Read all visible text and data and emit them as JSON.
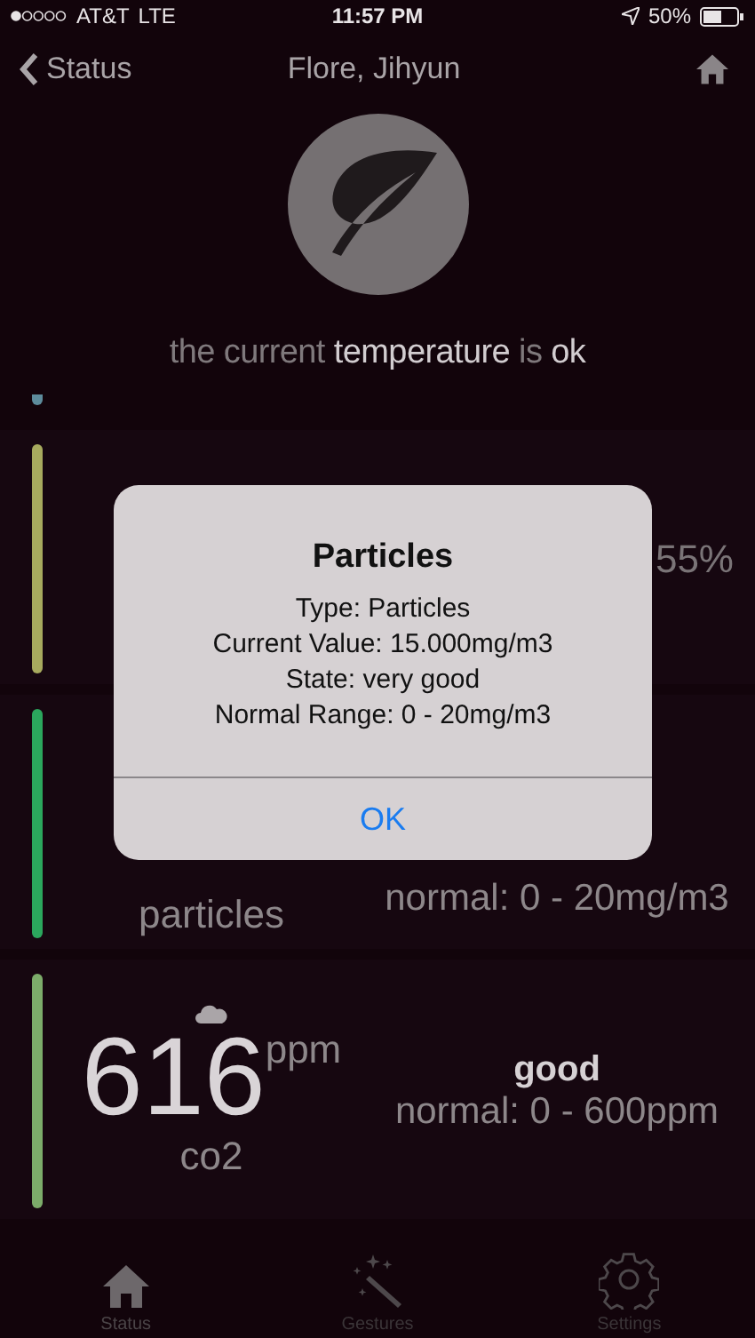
{
  "status_bar": {
    "carrier": "AT&T",
    "network": "LTE",
    "time": "11:57 PM",
    "battery": "50%"
  },
  "nav": {
    "back": "Status",
    "title": "Flore, Jihyun"
  },
  "caption": "the current **temperature** is **ok**",
  "sensors": [
    {
      "color": "#5d8c9c"
    },
    {
      "color": "#a7aa5e",
      "state": "55%"
    },
    {
      "color": "#2ba75d",
      "label": "particles",
      "range": "normal: 0 - 20mg/m3"
    },
    {
      "color": "#7cac6a",
      "value": "616",
      "unit": "ppm",
      "label": "co2",
      "state": "good",
      "range": "normal: 0 - 600ppm"
    }
  ],
  "alert": {
    "title": "Particles",
    "lines": [
      "Type: Particles",
      "Current Value: 15.000mg/m3",
      "State: very good",
      "Normal Range: 0 - 20mg/m3"
    ],
    "button": "OK"
  },
  "tabs": [
    {
      "label": "Status",
      "selected": true
    },
    {
      "label": "Gestures",
      "selected": false
    },
    {
      "label": "Settings",
      "selected": false
    }
  ]
}
